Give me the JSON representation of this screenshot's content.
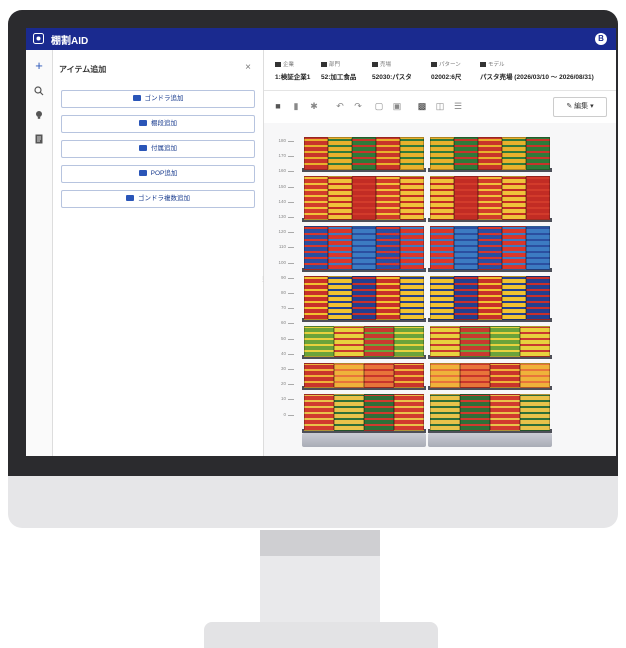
{
  "app": {
    "title": "棚割AID",
    "avatar": "B"
  },
  "rail": {
    "icons": [
      "plus-icon",
      "search-icon",
      "lightbulb-icon",
      "document-icon"
    ]
  },
  "panel": {
    "title": "アイテム追加",
    "close": "×",
    "buttons": [
      "ゴンドラ追加",
      "棚段追加",
      "付属追加",
      "POP追加",
      "ゴンドラ複数追加"
    ]
  },
  "info": [
    {
      "label": "企業",
      "value": "1:検証企業1"
    },
    {
      "label": "部門",
      "value": "52:加工食品"
    },
    {
      "label": "売場",
      "value": "52030:パスタ"
    },
    {
      "label": "パターン",
      "value": "02002:6尺"
    },
    {
      "label": "モデル",
      "value": "パスタ売場 (2026/03/10 〜 2026/08/31)"
    }
  ],
  "toolbar": {
    "edit_label": "編集"
  },
  "ruler": [
    "180",
    "170",
    "160",
    "150",
    "140",
    "130",
    "120",
    "110",
    "100",
    "90",
    "80",
    "70",
    "60",
    "50",
    "40",
    "30",
    "20",
    "10",
    "0"
  ],
  "colors": {
    "appbar": "#1a2a8f",
    "accent": "#2a55b8"
  }
}
